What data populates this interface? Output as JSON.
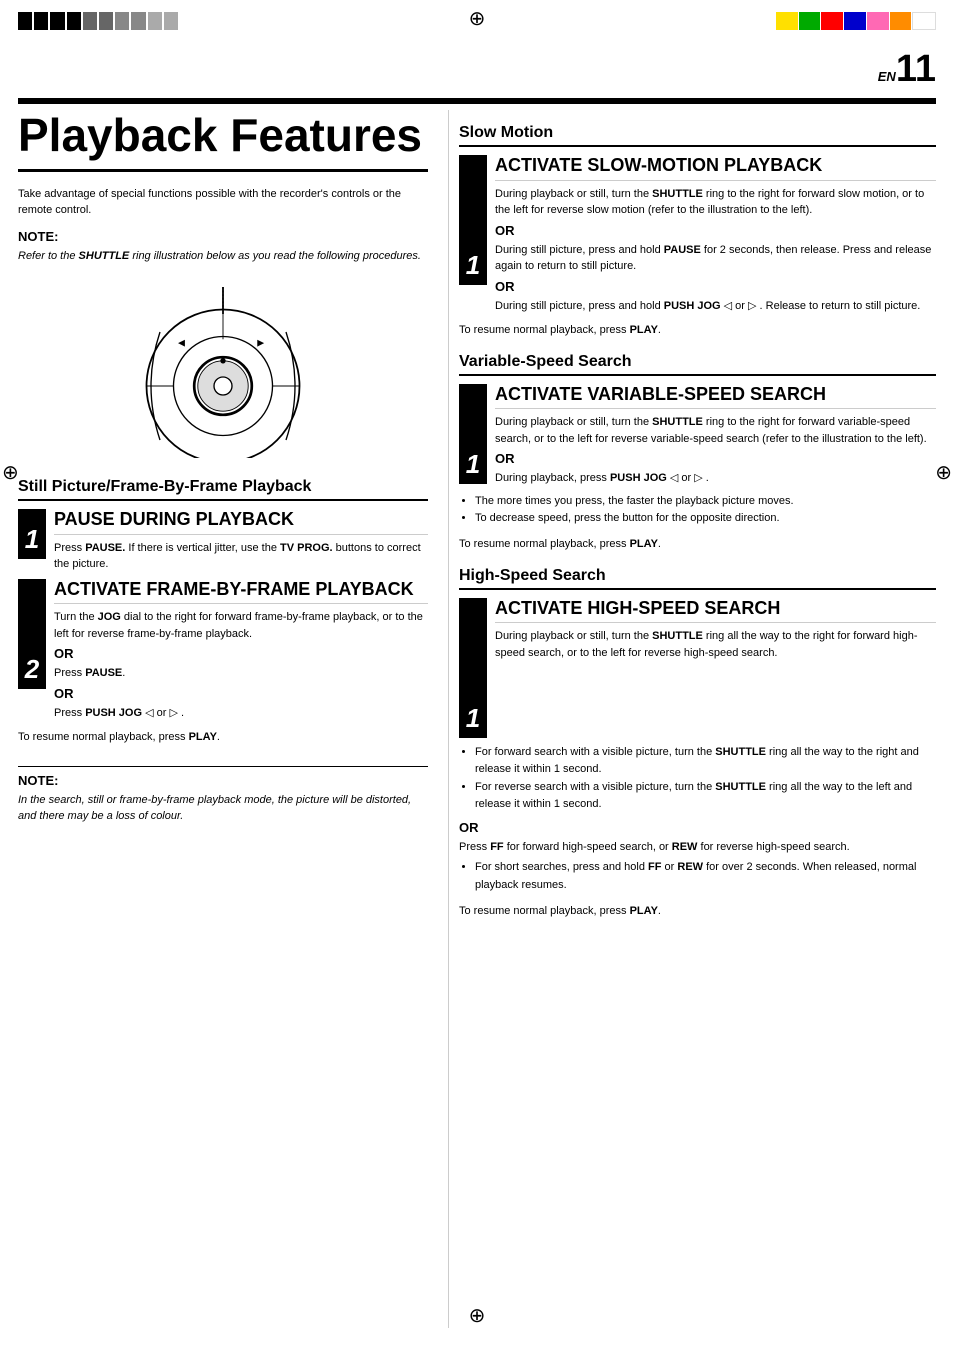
{
  "page": {
    "en_label": "EN",
    "page_number": "11",
    "colors": {
      "bar": [
        "#FFE000",
        "#00AA00",
        "#FF0000",
        "#0000CC",
        "#FF69B4",
        "#FF8C00",
        "#FFFFFF"
      ],
      "black_segs": [
        "#000",
        "#000",
        "#000",
        "#000",
        "#555",
        "#555",
        "#777",
        "#777",
        "#999",
        "#999"
      ]
    }
  },
  "left_col": {
    "title": "Playback Features",
    "intro": "Take advantage of special functions possible with the recorder's controls or the remote control.",
    "note_heading": "NOTE:",
    "note_body": "Refer to the SHUTTLE ring illustration below as you read the following procedures.",
    "section_still": "Still Picture/Frame-By-Frame Playback",
    "step1_pause_title": "PAUSE DURING PLAYBACK",
    "step1_pause_body": "Press PAUSE. If there is vertical jitter, use the TV PROG. buttons to correct the picture.",
    "step2_activate_title": "ACTIVATE FRAME-BY-FRAME PLAYBACK",
    "step2_activate_body": "Turn the JOG dial to the right for forward frame-by-frame playback, or to the left for reverse frame-by-frame playback.",
    "or1": "OR",
    "step2_or1": "Press PAUSE.",
    "or2": "OR",
    "step2_or2": "Press PUSH JOG ◁ or ▷ .",
    "resume_still": "To resume normal playback, press PLAY.",
    "bottom_note_heading": "NOTE:",
    "bottom_note_body": "In the search, still or frame-by-frame playback mode, the picture will be distorted, and there may be a loss of colour."
  },
  "right_col": {
    "section_slow": "Slow Motion",
    "slow_step_title": "ACTIVATE SLOW-MOTION PLAYBACK",
    "slow_step_body1": "During playback or still, turn the SHUTTLE ring to the right for forward slow motion, or to the left for reverse slow motion (refer to the illustration to the left).",
    "slow_or1": "OR",
    "slow_step_body2": "During still picture, press and hold PAUSE  for 2 seconds, then release. Press and release again to return to still picture.",
    "slow_or2": "OR",
    "slow_step_body3": "During still picture, press and hold PUSH JOG ◁ or ▷ . Release to return to still picture.",
    "slow_resume": "To resume normal playback, press PLAY.",
    "section_variable": "Variable-Speed Search",
    "var_step_title": "ACTIVATE VARIABLE-SPEED SEARCH",
    "var_step_body1": "During playback or still, turn the SHUTTLE ring to the right for forward variable-speed search, or to the left for reverse variable-speed search (refer to the illustration to the left).",
    "var_or1": "OR",
    "var_step_body2": "During playback, press PUSH JOG ◁ or ▷ .",
    "var_bullet1": "The more times you press, the faster the playback picture moves.",
    "var_bullet2": "To decrease speed, press the button for the opposite direction.",
    "var_resume": "To resume normal playback, press PLAY.",
    "section_high": "High-Speed Search",
    "high_step_title": "ACTIVATE HIGH-SPEED SEARCH",
    "high_step_body1": "During playback or still, turn the SHUTTLE ring all the way to the right for forward high-speed search, or to the left for reverse high-speed search.",
    "high_bullet1": "For forward search with a visible picture, turn the SHUTTLE ring all the way to the right and release it within 1 second.",
    "high_bullet2": "For reverse search with a visible picture, turn the SHUTTLE ring all the way to the left and release it within 1 second.",
    "high_or1": "OR",
    "high_step_body2": "Press FF for forward high-speed search, or REW for reverse high-speed search.",
    "high_bullet3": "For short searches, press and hold FF or REW for over 2 seconds. When released, normal playback resumes.",
    "high_resume": "To resume normal playback, press PLAY."
  }
}
